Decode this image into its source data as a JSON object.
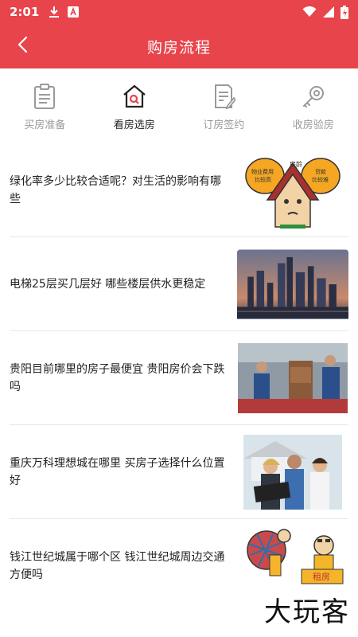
{
  "status": {
    "time": "2:01"
  },
  "header": {
    "title": "购房流程"
  },
  "tabs": [
    {
      "label": "买房准备",
      "icon": "clipboard-icon",
      "active": false
    },
    {
      "label": "看房选房",
      "icon": "house-search-icon",
      "active": true
    },
    {
      "label": "订房签约",
      "icon": "contract-icon",
      "active": false
    },
    {
      "label": "收房验房",
      "icon": "key-icon",
      "active": false
    }
  ],
  "articles": [
    {
      "title": "绿化率多少比较合适呢？对生活的影响有哪些",
      "thumb": "cartoon-house-image",
      "thumb_labels": [
        "房龄",
        "物业费用",
        "比较高",
        "贷款",
        "比较难"
      ]
    },
    {
      "title": "电梯25层买几层好 哪些楼层供水更稳定",
      "thumb": "city-skyline-image"
    },
    {
      "title": "贵阳目前哪里的房子最便宜 贵阳房价会下跌吗",
      "thumb": "movers-photo-image"
    },
    {
      "title": "重庆万科理想城在哪里 买房子选择什么位置好",
      "thumb": "family-house-photo-image"
    },
    {
      "title": "钱江世纪城属于哪个区 钱江世纪城周边交通方便吗",
      "thumb": "cartoon-rent-image",
      "thumb_labels": [
        "租房"
      ]
    }
  ],
  "watermark": "大玩客",
  "colors": {
    "primary": "#e8444b",
    "divider": "#e6e6e6"
  }
}
